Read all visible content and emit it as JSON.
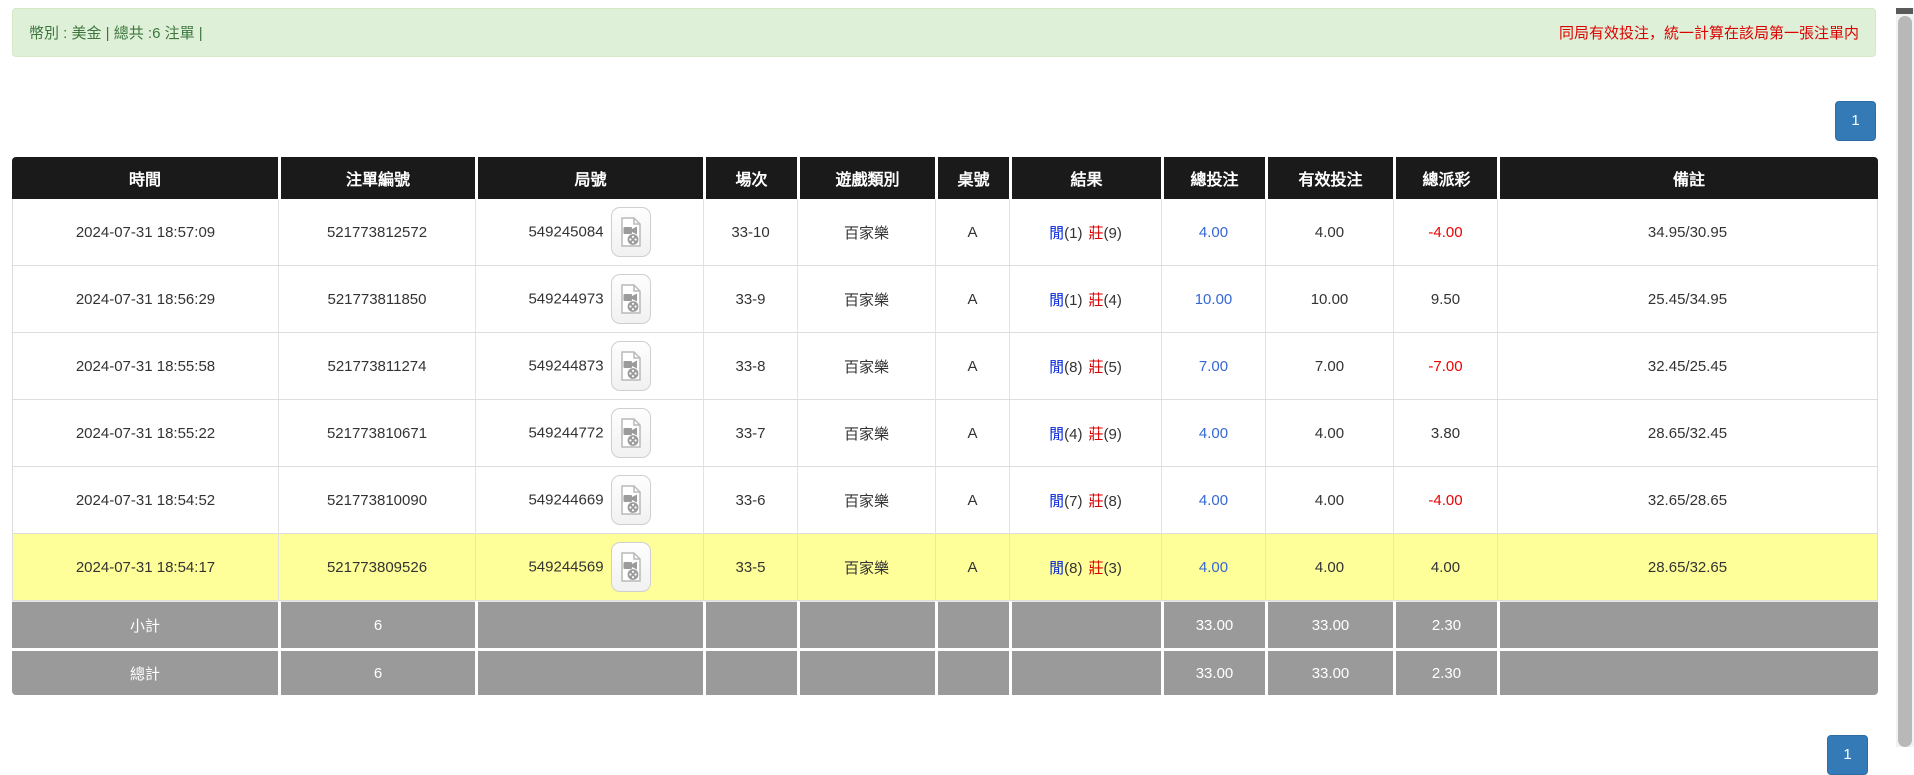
{
  "info_bar": {
    "summary": "幣別 : 美金 | 總共 :6 注單 |",
    "notice": "同局有效投注，統一計算在該局第一張注單内"
  },
  "pagination": {
    "current_page": "1"
  },
  "table": {
    "headers": [
      "時間",
      "注單編號",
      "局號",
      "場次",
      "遊戲類別",
      "桌號",
      "結果",
      "總投注",
      "有效投注",
      "總派彩",
      "備註"
    ],
    "rows": [
      {
        "time": "2024-07-31 18:57:09",
        "bet_id": "521773812572",
        "round_id": "549245084",
        "session": "33-10",
        "game": "百家樂",
        "table_no": "A",
        "result": {
          "player_label": "閒",
          "player_value": "(1)",
          "banker_label": "莊",
          "banker_value": "(9)"
        },
        "total_bet": "4.00",
        "valid_bet": "4.00",
        "payout": "-4.00",
        "remark": "34.95/30.95",
        "highlighted": false
      },
      {
        "time": "2024-07-31 18:56:29",
        "bet_id": "521773811850",
        "round_id": "549244973",
        "session": "33-9",
        "game": "百家樂",
        "table_no": "A",
        "result": {
          "player_label": "閒",
          "player_value": "(1)",
          "banker_label": "莊",
          "banker_value": "(4)"
        },
        "total_bet": "10.00",
        "valid_bet": "10.00",
        "payout": "9.50",
        "remark": "25.45/34.95",
        "highlighted": false
      },
      {
        "time": "2024-07-31 18:55:58",
        "bet_id": "521773811274",
        "round_id": "549244873",
        "session": "33-8",
        "game": "百家樂",
        "table_no": "A",
        "result": {
          "player_label": "閒",
          "player_value": "(8)",
          "banker_label": "莊",
          "banker_value": "(5)"
        },
        "total_bet": "7.00",
        "valid_bet": "7.00",
        "payout": "-7.00",
        "remark": "32.45/25.45",
        "highlighted": false
      },
      {
        "time": "2024-07-31 18:55:22",
        "bet_id": "521773810671",
        "round_id": "549244772",
        "session": "33-7",
        "game": "百家樂",
        "table_no": "A",
        "result": {
          "player_label": "閒",
          "player_value": "(4)",
          "banker_label": "莊",
          "banker_value": "(9)"
        },
        "total_bet": "4.00",
        "valid_bet": "4.00",
        "payout": "3.80",
        "remark": "28.65/32.45",
        "highlighted": false
      },
      {
        "time": "2024-07-31 18:54:52",
        "bet_id": "521773810090",
        "round_id": "549244669",
        "session": "33-6",
        "game": "百家樂",
        "table_no": "A",
        "result": {
          "player_label": "閒",
          "player_value": "(7)",
          "banker_label": "莊",
          "banker_value": "(8)"
        },
        "total_bet": "4.00",
        "valid_bet": "4.00",
        "payout": "-4.00",
        "remark": "32.65/28.65",
        "highlighted": false
      },
      {
        "time": "2024-07-31 18:54:17",
        "bet_id": "521773809526",
        "round_id": "549244569",
        "session": "33-5",
        "game": "百家樂",
        "table_no": "A",
        "result": {
          "player_label": "閒",
          "player_value": "(8)",
          "banker_label": "莊",
          "banker_value": "(3)"
        },
        "total_bet": "4.00",
        "valid_bet": "4.00",
        "payout": "4.00",
        "remark": "28.65/32.65",
        "highlighted": true
      }
    ],
    "subtotal": {
      "label": "小計",
      "count": "6",
      "total_bet": "33.00",
      "valid_bet": "33.00",
      "payout": "2.30"
    },
    "grand_total": {
      "label": "總計",
      "count": "6",
      "total_bet": "33.00",
      "valid_bet": "33.00",
      "payout": "2.30"
    }
  },
  "icons": {
    "video_replay": "video-film-document-icon"
  },
  "colors": {
    "success_bg": "#dff0d8",
    "success_text": "#3c763d",
    "notice_red": "#dd0000",
    "header_bg": "#1a1a1a",
    "highlight_row": "#ffff99",
    "summary_row_bg": "#9a9a9a",
    "link_blue": "#3568d6",
    "player_blue": "#0022dd",
    "banker_red": "#dd0000",
    "negative_red": "#ee0000",
    "pagination_blue": "#337ab7"
  }
}
